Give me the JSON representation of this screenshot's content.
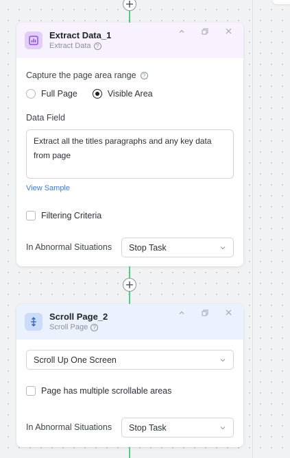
{
  "nodes": [
    {
      "title": "Extract Data_1",
      "subtitle": "Extract Data",
      "icon": "bar-chart-icon",
      "capture_label": "Capture the page area range",
      "options": [
        "Full Page",
        "Visible Area"
      ],
      "selected_option": "Visible Area",
      "data_field_label": "Data Field",
      "data_field_value": "Extract all the titles paragraphs and any key data from page",
      "view_sample": "View Sample",
      "filtering_label": "Filtering Criteria",
      "abnormal_label": "In Abnormal Situations",
      "abnormal_value": "Stop Task"
    },
    {
      "title": "Scroll Page_2",
      "subtitle": "Scroll Page",
      "icon": "scroll-vertical-icon",
      "scroll_value": "Scroll Up One Screen",
      "multi_scroll_label": "Page has multiple scrollable areas",
      "abnormal_label": "In Abnormal Situations",
      "abnormal_value": "Stop Task"
    }
  ],
  "colors": {
    "connector": "#4ad07e",
    "extract_header": "#f8f2fe",
    "scroll_header": "#ecf2fd",
    "link": "#3a7be5"
  }
}
